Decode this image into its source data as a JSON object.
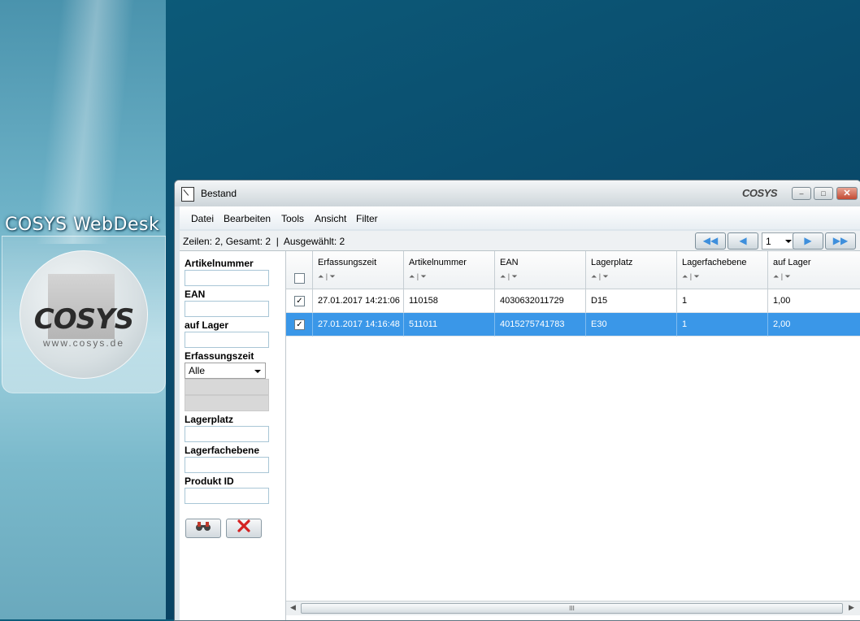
{
  "desktop": {
    "title": "COSYS WebDesk",
    "logo_word": "COSYS",
    "logo_url": "www.cosys.de"
  },
  "window": {
    "title": "Bestand",
    "title_logo": "COSYS",
    "controls": {
      "minimize": "–",
      "maximize": "□",
      "close": "✕"
    }
  },
  "menu": [
    "Datei",
    "Bearbeiten",
    "Tools",
    "Ansicht",
    "Filter"
  ],
  "status": {
    "text": "Zeilen: 2, Gesamt: 2  |  Ausgewählt: 2",
    "page": "1",
    "nav": {
      "first": "◀◀",
      "prev": "◀",
      "next": "▶",
      "last": "▶▶"
    }
  },
  "filters": {
    "artikelnummer": {
      "label": "Artikelnummer",
      "value": ""
    },
    "ean": {
      "label": "EAN",
      "value": ""
    },
    "auf_lager": {
      "label": "auf Lager",
      "value": ""
    },
    "erfassungszeit": {
      "label": "Erfassungszeit",
      "selected": "Alle"
    },
    "lagerplatz": {
      "label": "Lagerplatz",
      "value": ""
    },
    "lagerfachebene": {
      "label": "Lagerfachebene",
      "value": ""
    },
    "produkt_id": {
      "label": "Produkt ID",
      "value": ""
    }
  },
  "table": {
    "columns": [
      "Erfassungszeit",
      "Artikelnummer",
      "EAN",
      "Lagerplatz",
      "Lagerfachebene",
      "auf Lager"
    ],
    "sort_glyph": "⏶ | ⏷",
    "rows": [
      {
        "checked": true,
        "selected": false,
        "cells": [
          "27.01.2017 14:21:06",
          "110158",
          "4030632011729",
          "D15",
          "1",
          "1,00"
        ]
      },
      {
        "checked": true,
        "selected": true,
        "cells": [
          "27.01.2017 14:16:48",
          "511011",
          "4015275741783",
          "E30",
          "1",
          "2,00"
        ]
      }
    ],
    "scroll_grip": "III",
    "scroll_left": "◀",
    "scroll_right": "▶"
  },
  "colors": {
    "selection": "#3a97e8",
    "desktop_bg": "#0a4d6e",
    "close_button": "#c24a33"
  },
  "icons": {
    "search_button": "binoculars-icon",
    "reset_button": "red-x-icon"
  }
}
